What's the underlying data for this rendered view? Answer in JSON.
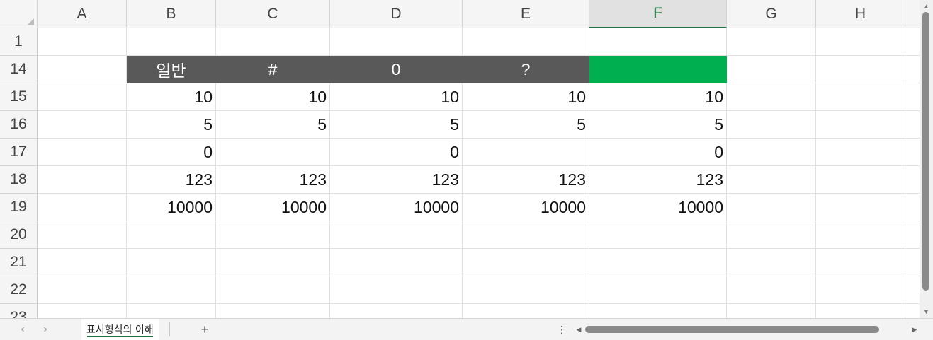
{
  "columns": [
    "A",
    "B",
    "C",
    "D",
    "E",
    "F",
    "G",
    "H"
  ],
  "selected_column": "F",
  "rows": [
    {
      "num": "1",
      "cells": [
        "",
        "",
        "",
        "",
        "",
        ""
      ]
    },
    {
      "num": "14",
      "cells": [
        "",
        "일반",
        "#",
        "0",
        "?",
        ""
      ]
    },
    {
      "num": "15",
      "cells": [
        "",
        "10",
        "10",
        "10",
        "10",
        "10"
      ]
    },
    {
      "num": "16",
      "cells": [
        "",
        "5",
        "5",
        "5",
        "5",
        "5"
      ]
    },
    {
      "num": "17",
      "cells": [
        "",
        "0",
        "",
        "0",
        "",
        "0"
      ]
    },
    {
      "num": "18",
      "cells": [
        "",
        "123",
        "123",
        "123",
        "123",
        "123"
      ]
    },
    {
      "num": "19",
      "cells": [
        "",
        "10000",
        "10000",
        "10000",
        "10000",
        "10000"
      ]
    },
    {
      "num": "20",
      "cells": [
        "",
        "",
        "",
        "",
        "",
        ""
      ]
    },
    {
      "num": "21",
      "cells": [
        "",
        "",
        "",
        "",
        "",
        ""
      ]
    },
    {
      "num": "22",
      "cells": [
        "",
        "",
        "",
        "",
        "",
        ""
      ]
    },
    {
      "num": "23",
      "cells": [
        "",
        "",
        "",
        "",
        "",
        ""
      ]
    }
  ],
  "colors": {
    "header_fill": "#595959",
    "highlight_fill": "#00b050",
    "accent": "#1e7145"
  },
  "sheet_tabs": [
    {
      "label": "표시형식의 이해",
      "active": true
    }
  ],
  "bottom": {
    "prev_icon": "chevron-left-icon",
    "next_icon": "chevron-right-icon",
    "add_sheet": "+",
    "options_icon": "vertical-dots-icon",
    "prev_glyph": "‹",
    "next_glyph": "›",
    "dots_glyph": "⋮"
  }
}
